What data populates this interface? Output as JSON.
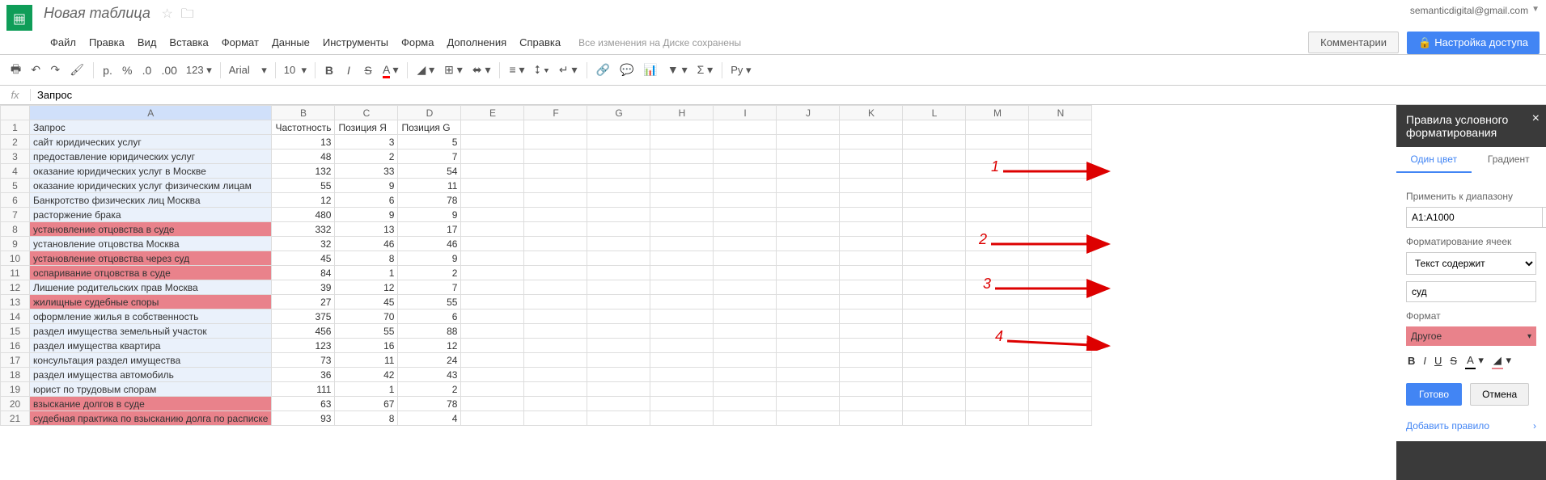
{
  "header": {
    "doc_title": "Новая таблица",
    "user_email": "semanticdigital@gmail.com",
    "comments_btn": "Комментарии",
    "share_btn": "Настройка доступа"
  },
  "menu": [
    "Файл",
    "Правка",
    "Вид",
    "Вставка",
    "Формат",
    "Данные",
    "Инструменты",
    "Форма",
    "Дополнения",
    "Справка"
  ],
  "save_status": "Все изменения на Диске сохранены",
  "toolbar": {
    "currency": "р.",
    "percent": "%",
    "dec_dec": ".0",
    "dec_inc": ".00",
    "format_more": "123",
    "font": "Arial",
    "size": "10",
    "ru": "Ру"
  },
  "fx_value": "Запрос",
  "columns": [
    "A",
    "B",
    "C",
    "D",
    "E",
    "F",
    "G",
    "H",
    "I",
    "J",
    "K",
    "L",
    "M",
    "N"
  ],
  "headers_row": [
    "Запрос",
    "Частотность",
    "Позиция Я",
    "Позиция G"
  ],
  "rows": [
    {
      "a": "сайт юридических услуг",
      "b": 13,
      "c": 3,
      "d": 5,
      "hl": false
    },
    {
      "a": "предоставление юридических услуг",
      "b": 48,
      "c": 2,
      "d": 7,
      "hl": false
    },
    {
      "a": "оказание юридических услуг в Москве",
      "b": 132,
      "c": 33,
      "d": 54,
      "hl": false
    },
    {
      "a": "оказание юридических услуг физическим лицам",
      "b": 55,
      "c": 9,
      "d": 11,
      "hl": false
    },
    {
      "a": "Банкротство физических лиц Москва",
      "b": 12,
      "c": 6,
      "d": 78,
      "hl": false
    },
    {
      "a": "расторжение брака",
      "b": 480,
      "c": 9,
      "d": 9,
      "hl": false
    },
    {
      "a": "установление отцовства в суде",
      "b": 332,
      "c": 13,
      "d": 17,
      "hl": true
    },
    {
      "a": "установление отцовства Москва",
      "b": 32,
      "c": 46,
      "d": 46,
      "hl": false
    },
    {
      "a": "установление отцовства через суд",
      "b": 45,
      "c": 8,
      "d": 9,
      "hl": true
    },
    {
      "a": "оспаривание отцовства в суде",
      "b": 84,
      "c": 1,
      "d": 2,
      "hl": true
    },
    {
      "a": "Лишение родительских прав Москва",
      "b": 39,
      "c": 12,
      "d": 7,
      "hl": false
    },
    {
      "a": "жилищные судебные споры",
      "b": 27,
      "c": 45,
      "d": 55,
      "hl": true
    },
    {
      "a": "оформление жилья в собственность",
      "b": 375,
      "c": 70,
      "d": 6,
      "hl": false
    },
    {
      "a": "раздел имущества земельный участок",
      "b": 456,
      "c": 55,
      "d": 88,
      "hl": false
    },
    {
      "a": "раздел имущества квартира",
      "b": 123,
      "c": 16,
      "d": 12,
      "hl": false
    },
    {
      "a": "консультация раздел имущества",
      "b": 73,
      "c": 11,
      "d": 24,
      "hl": false
    },
    {
      "a": "раздел имущества автомобиль",
      "b": 36,
      "c": 42,
      "d": 43,
      "hl": false
    },
    {
      "a": "юрист по трудовым спорам",
      "b": 111,
      "c": 1,
      "d": 2,
      "hl": false
    },
    {
      "a": "взыскание долгов в суде",
      "b": 63,
      "c": 67,
      "d": 78,
      "hl": true
    },
    {
      "a": "судебная практика по взысканию долга по расписке",
      "b": 93,
      "c": 8,
      "d": 4,
      "hl": true
    }
  ],
  "panel": {
    "title": "Правила условного форматирования",
    "tab1": "Один цвет",
    "tab2": "Градиент",
    "apply_range_label": "Применить к диапазону",
    "range": "A1:A1000",
    "format_cells_label": "Форматирование ячеек",
    "condition": "Текст содержит",
    "condition_value": "суд",
    "format_label": "Формат",
    "format_preset": "Другое",
    "done": "Готово",
    "cancel": "Отмена",
    "add_rule": "Добавить правило"
  },
  "annotations": {
    "n1": "1",
    "n2": "2",
    "n3": "3",
    "n4": "4"
  }
}
